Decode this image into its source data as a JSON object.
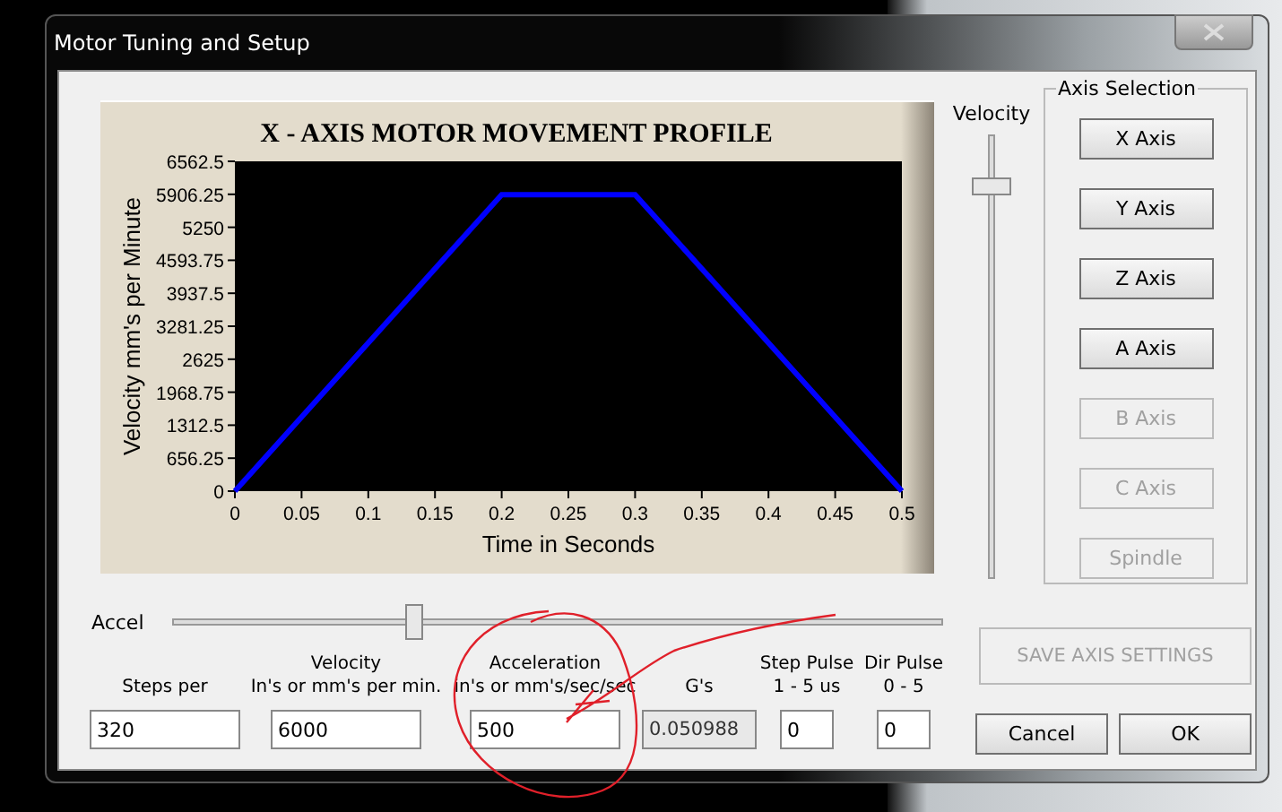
{
  "window": {
    "title": "Motor Tuning and Setup"
  },
  "chart": {
    "chart_data": {
      "type": "line",
      "title": "X - AXIS MOTOR MOVEMENT PROFILE",
      "xlabel": "Time in Seconds",
      "ylabel": "Velocity mm's per Minute",
      "x": [
        0,
        0.2,
        0.3,
        0.5
      ],
      "series": [
        {
          "color": "#0000ff",
          "values": [
            0,
            5900,
            5900,
            0
          ]
        }
      ],
      "xlim": [
        0,
        0.5
      ],
      "ylim": [
        0,
        6562.5
      ],
      "xticks": [
        0,
        0.05,
        0.1,
        0.15,
        0.2,
        0.25,
        0.3,
        0.35,
        0.4,
        0.45,
        0.5
      ],
      "yticks": [
        0,
        656.25,
        1312.5,
        1968.75,
        2625,
        3281.25,
        3937.5,
        4593.75,
        5250,
        5906.25,
        6562.5
      ]
    }
  },
  "velocity_slider": {
    "label": "Velocity",
    "level": 0.9
  },
  "axis_selection": {
    "title": "Axis Selection",
    "buttons": [
      {
        "label": "X Axis",
        "disabled": false
      },
      {
        "label": "Y Axis",
        "disabled": false
      },
      {
        "label": "Z Axis",
        "disabled": false
      },
      {
        "label": "A Axis",
        "disabled": false
      },
      {
        "label": "B Axis",
        "disabled": true
      },
      {
        "label": "C Axis",
        "disabled": true
      },
      {
        "label": "Spindle",
        "disabled": true
      }
    ]
  },
  "accel_slider": {
    "label": "Accel",
    "level": 0.31
  },
  "fields": [
    {
      "label_lines": [
        "Steps per"
      ],
      "value": "320",
      "readonly": false
    },
    {
      "label_lines": [
        "Velocity",
        "In's or mm's per min."
      ],
      "value": "6000",
      "readonly": false
    },
    {
      "label_lines": [
        "Acceleration",
        "in's or mm's/sec/sec"
      ],
      "value": "500",
      "readonly": false
    },
    {
      "label_lines": [
        "G's"
      ],
      "value": "0.050988",
      "readonly": true
    },
    {
      "label_lines": [
        "Step Pulse",
        "1 - 5 us"
      ],
      "value": "0",
      "readonly": false
    },
    {
      "label_lines": [
        "Dir Pulse",
        "0 - 5"
      ],
      "value": "0",
      "readonly": false
    }
  ],
  "save_button": {
    "label": "SAVE AXIS SETTINGS",
    "disabled": true
  },
  "buttons": [
    "Cancel",
    "OK"
  ]
}
